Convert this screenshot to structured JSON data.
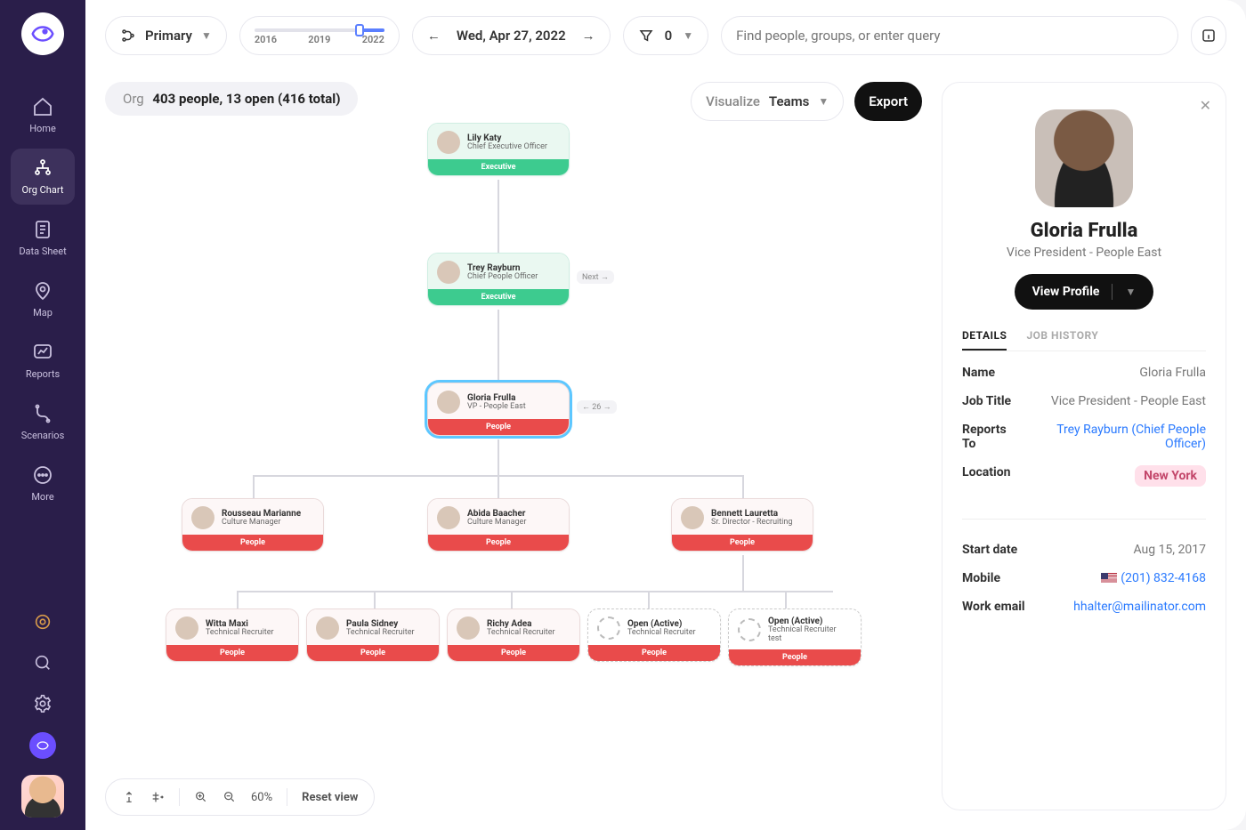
{
  "sidebar": {
    "items": [
      {
        "label": "Home"
      },
      {
        "label": "Org Chart"
      },
      {
        "label": "Data Sheet"
      },
      {
        "label": "Map"
      },
      {
        "label": "Reports"
      },
      {
        "label": "Scenarios"
      },
      {
        "label": "More"
      }
    ]
  },
  "topbar": {
    "view_selector": "Primary",
    "timeline": {
      "y1": "2016",
      "y2": "2019",
      "y3": "2022"
    },
    "date": "Wed, Apr 27, 2022",
    "filter_count": "0",
    "search_placeholder": "Find people, groups, or enter query"
  },
  "org_stat": {
    "label": "Org",
    "text": "403 people, 13 open (416 total)"
  },
  "visualize": {
    "label": "Visualize",
    "value": "Teams"
  },
  "export_label": "Export",
  "nodes": {
    "n1": {
      "name": "Lily Katy",
      "title": "Chief Executive Officer",
      "group": "Executive"
    },
    "n2": {
      "name": "Trey Rayburn",
      "title": "Chief People Officer",
      "group": "Executive",
      "badge": "Next →"
    },
    "n3": {
      "name": "Gloria Frulla",
      "title": "VP - People East",
      "group": "People",
      "badge": "← 26 →"
    },
    "n4": {
      "name": "Rousseau Marianne",
      "title": "Culture Manager",
      "group": "People"
    },
    "n5": {
      "name": "Abida Baacher",
      "title": "Culture Manager",
      "group": "People"
    },
    "n6": {
      "name": "Bennett Lauretta",
      "title": "Sr. Director - Recruiting",
      "group": "People"
    },
    "n7": {
      "name": "Witta Maxi",
      "title": "Technical Recruiter",
      "group": "People"
    },
    "n8": {
      "name": "Paula Sidney",
      "title": "Technical Recruiter",
      "group": "People"
    },
    "n9": {
      "name": "Richy Adea",
      "title": "Technical Recruiter",
      "group": "People"
    },
    "n10": {
      "name": "Open (Active)",
      "title": "Technical Recruiter",
      "group": "People"
    },
    "n11": {
      "name": "Open (Active)",
      "title": "Technical Recruiter test",
      "group": "People"
    }
  },
  "bottom": {
    "zoom": "60%",
    "reset": "Reset view"
  },
  "panel": {
    "name": "Gloria Frulla",
    "subtitle": "Vice President - People East",
    "view_profile": "View Profile",
    "tabs": {
      "details": "DETAILS",
      "history": "JOB HISTORY"
    },
    "fields": {
      "name_k": "Name",
      "name_v": "Gloria Frulla",
      "title_k": "Job Title",
      "title_v": "Vice President - People East",
      "reports_k": "Reports To",
      "reports_v": "Trey Rayburn (Chief People Officer)",
      "location_k": "Location",
      "location_v": "New York",
      "start_k": "Start date",
      "start_v": "Aug 15, 2017",
      "mobile_k": "Mobile",
      "mobile_v": "(201) 832-4168",
      "email_k": "Work email",
      "email_v": "hhalter@mailinator.com"
    }
  }
}
